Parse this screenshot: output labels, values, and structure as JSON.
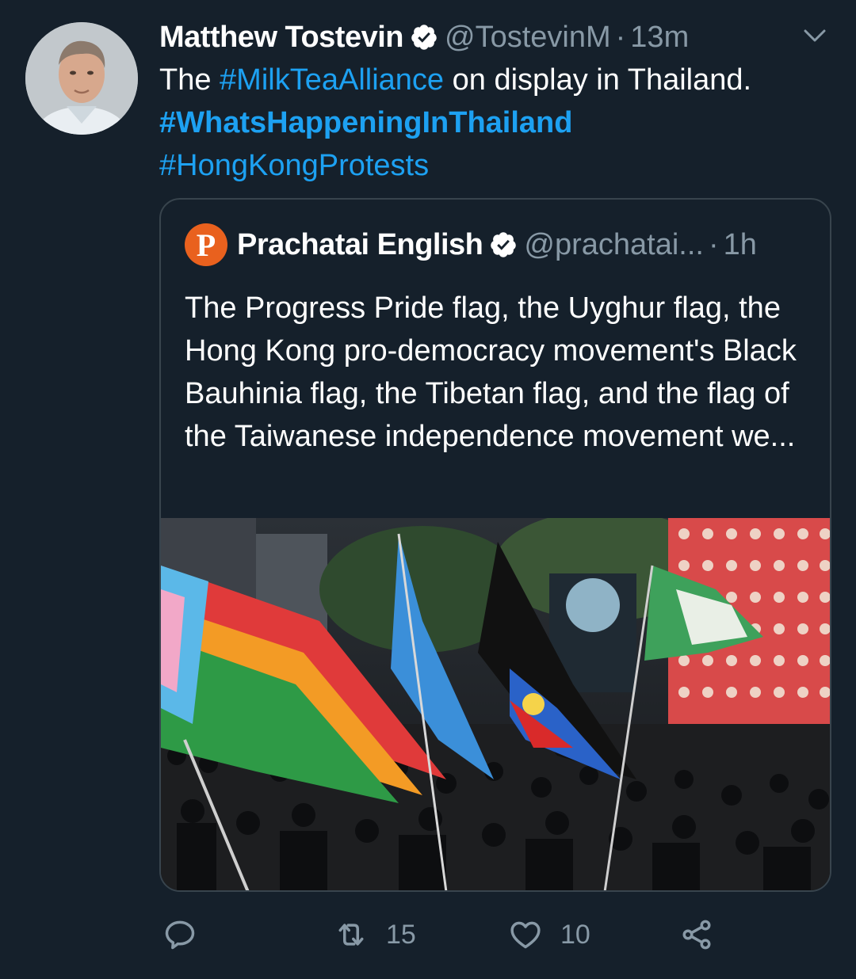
{
  "tweet": {
    "author_name": "Matthew Tostevin",
    "author_handle": "@TostevinM",
    "separator": "·",
    "time": "13m",
    "text_prefix": "The ",
    "hashtag_1": "#MilkTeaAlliance",
    "text_middle": " on display in Thailand.",
    "hashtag_2": "#WhatsHappeningInThailand",
    "hashtag_3": "#HongKongProtests"
  },
  "quoted_tweet": {
    "logo_letter": "P",
    "author_name": "Prachatai English",
    "author_handle": "@prachatai...",
    "separator": "·",
    "time": "1h",
    "text": "The Progress Pride flag, the Uyghur flag, the Hong Kong pro-democracy movement's Black Bauhinia flag, the Tibetan flag, and the flag of the Taiwanese independence movement we..."
  },
  "actions": {
    "reply_icon": "reply-icon",
    "retweet_icon": "retweet-icon",
    "retweet_count": "15",
    "like_icon": "heart-icon",
    "like_count": "10",
    "share_icon": "share-icon"
  },
  "colors": {
    "background": "#15202b",
    "link": "#1da1f2",
    "secondary_text": "#8899a6",
    "border": "#38444d",
    "logo": "#e9611e"
  }
}
